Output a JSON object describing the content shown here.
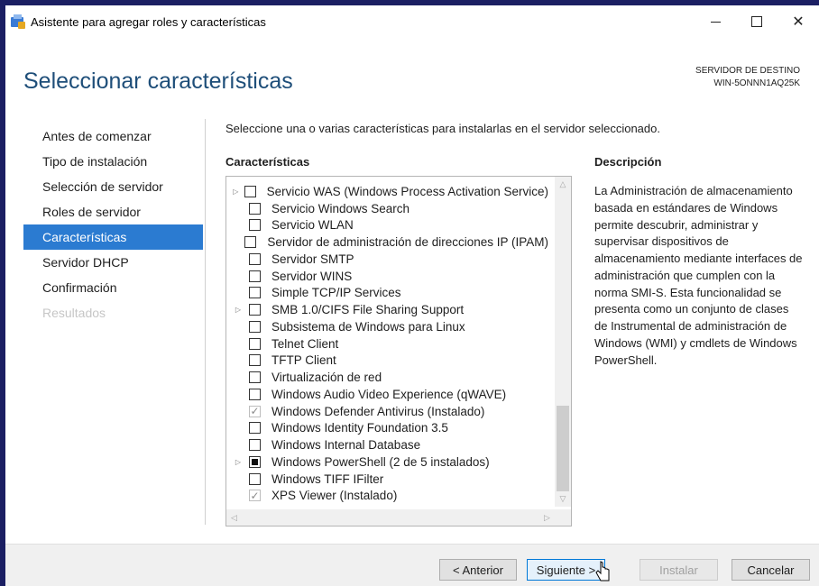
{
  "window": {
    "title": "Asistente para agregar roles y características",
    "controls": {
      "minimize_icon": "minimize-icon",
      "maximize_icon": "maximize-icon",
      "close_label": "✕"
    }
  },
  "header": {
    "page_title": "Seleccionar características",
    "destination_label": "SERVIDOR DE DESTINO",
    "destination_server": "WIN-5ONNN1AQ25K"
  },
  "nav": {
    "items": [
      {
        "label": "Antes de comenzar",
        "state": "normal"
      },
      {
        "label": "Tipo de instalación",
        "state": "normal"
      },
      {
        "label": "Selección de servidor",
        "state": "normal"
      },
      {
        "label": "Roles de servidor",
        "state": "normal"
      },
      {
        "label": "Características",
        "state": "active"
      },
      {
        "label": "Servidor DHCP",
        "state": "normal"
      },
      {
        "label": "Confirmación",
        "state": "normal"
      },
      {
        "label": "Resultados",
        "state": "disabled"
      }
    ]
  },
  "main": {
    "intro": "Seleccione una o varias características para instalarlas en el servidor seleccionado.",
    "features_heading": "Características",
    "features": [
      {
        "label": "Servicio WAS (Windows Process Activation Service)",
        "state": "unchecked",
        "expandable": true
      },
      {
        "label": "Servicio Windows Search",
        "state": "unchecked",
        "expandable": false
      },
      {
        "label": "Servicio WLAN",
        "state": "unchecked",
        "expandable": false
      },
      {
        "label": "Servidor de administración de direcciones IP (IPAM)",
        "state": "unchecked",
        "expandable": false
      },
      {
        "label": "Servidor SMTP",
        "state": "unchecked",
        "expandable": false
      },
      {
        "label": "Servidor WINS",
        "state": "unchecked",
        "expandable": false
      },
      {
        "label": "Simple TCP/IP Services",
        "state": "unchecked",
        "expandable": false
      },
      {
        "label": "SMB 1.0/CIFS File Sharing Support",
        "state": "unchecked",
        "expandable": true
      },
      {
        "label": "Subsistema de Windows para Linux",
        "state": "unchecked",
        "expandable": false
      },
      {
        "label": "Telnet Client",
        "state": "unchecked",
        "expandable": false
      },
      {
        "label": "TFTP Client",
        "state": "unchecked",
        "expandable": false
      },
      {
        "label": "Virtualización de red",
        "state": "unchecked",
        "expandable": false
      },
      {
        "label": "Windows Audio Video Experience (qWAVE)",
        "state": "unchecked",
        "expandable": false
      },
      {
        "label": "Windows Defender Antivirus (Instalado)",
        "state": "checked",
        "expandable": false
      },
      {
        "label": "Windows Identity Foundation 3.5",
        "state": "unchecked",
        "expandable": false
      },
      {
        "label": "Windows Internal Database",
        "state": "unchecked",
        "expandable": false
      },
      {
        "label": "Windows PowerShell (2 de 5 instalados)",
        "state": "partial",
        "expandable": true
      },
      {
        "label": "Windows TIFF IFilter",
        "state": "unchecked",
        "expandable": false
      },
      {
        "label": "XPS Viewer (Instalado)",
        "state": "checked",
        "expandable": false
      }
    ],
    "scroll_position_fraction": 1.0,
    "description_heading": "Descripción",
    "description": "La Administración de almacenamiento basada en estándares de Windows permite descubrir, administrar y supervisar dispositivos de almacenamiento mediante interfaces de administración que cumplen con la norma SMI-S. Esta funcionalidad se presenta como un conjunto de clases de Instrumental de administración de Windows (WMI) y cmdlets de Windows PowerShell."
  },
  "footer": {
    "previous_label": "< Anterior",
    "next_label": "Siguiente >",
    "install_label": "Instalar",
    "cancel_label": "Cancelar"
  },
  "colors": {
    "desktop_bg": "#1b1f63",
    "title_blue": "#1e4e79",
    "nav_active_bg": "#2b7bd1",
    "primary_button_border": "#0078d7"
  }
}
